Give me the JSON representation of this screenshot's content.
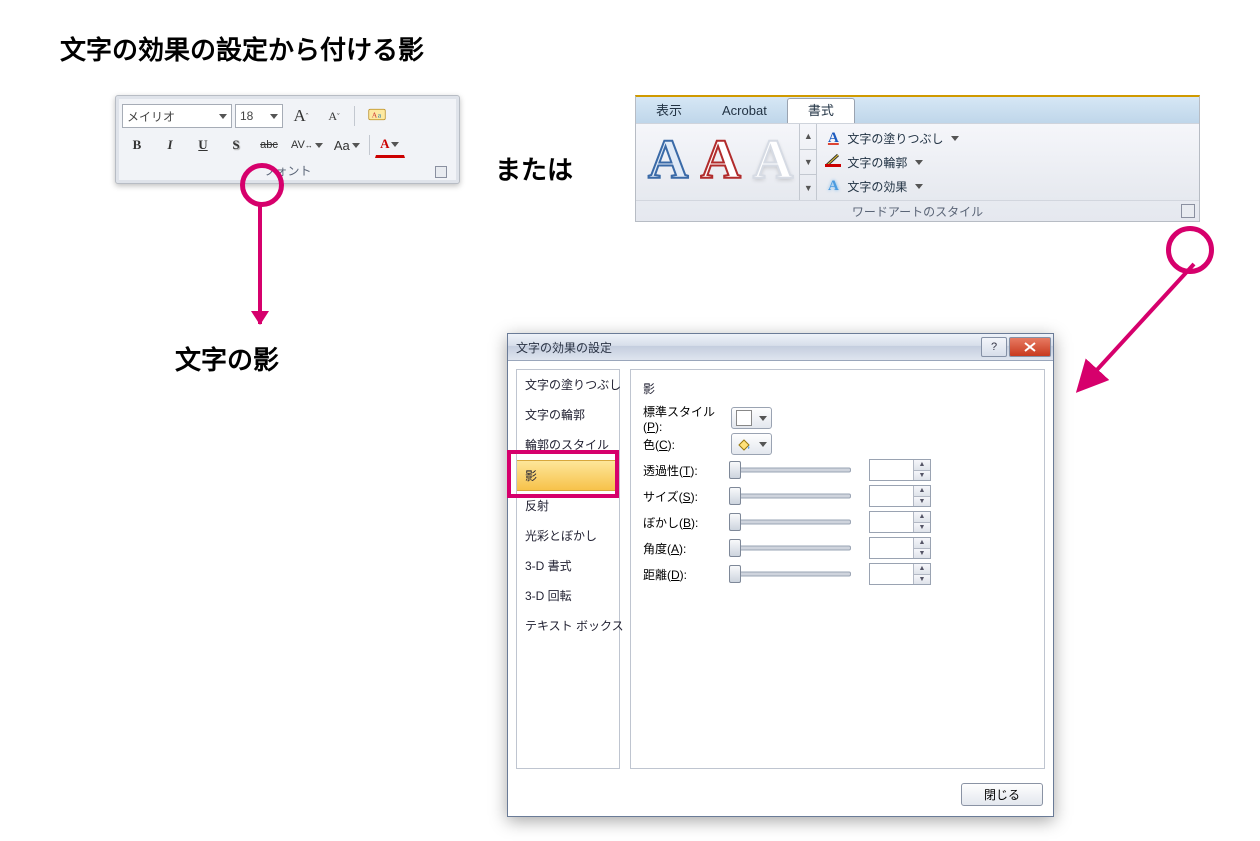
{
  "page_title": "文字の効果の設定から付ける影",
  "or_label": "または",
  "shadow_callout_label": "文字の影",
  "font_toolbar": {
    "font_name": "メイリオ",
    "font_size": "18",
    "increase_font": "A",
    "decrease_font": "A",
    "group_label": "フォント",
    "bold": "B",
    "italic": "I",
    "underline": "U",
    "shadow_s": "S",
    "strike": "abc",
    "char_spacing": "AV",
    "change_case": "Aa",
    "font_color_a": "A"
  },
  "ribbon": {
    "tabs": {
      "view": "表示",
      "acrobat": "Acrobat",
      "format": "書式"
    },
    "wordart_letter": "A",
    "options": {
      "fill": "文字の塗りつぶし",
      "outline": "文字の輪郭",
      "effects": "文字の効果"
    },
    "group_label": "ワードアートのスタイル"
  },
  "dialog": {
    "title": "文字の効果の設定",
    "nav": {
      "fill": "文字の塗りつぶし",
      "outline": "文字の輪郭",
      "outline_style": "輪郭のスタイル",
      "shadow": "影",
      "reflection": "反射",
      "glow": "光彩とぼかし",
      "format3d": "3-D 書式",
      "rotate3d": "3-D 回転",
      "textbox": "テキスト ボックス"
    },
    "panel": {
      "heading": "影",
      "preset": "標準スタイル(P):",
      "color": "色(C):",
      "transparency": "透過性(T):",
      "size": "サイズ(S):",
      "blur": "ぼかし(B):",
      "angle": "角度(A):",
      "distance": "距離(D):"
    },
    "close_btn": "閉じる"
  }
}
